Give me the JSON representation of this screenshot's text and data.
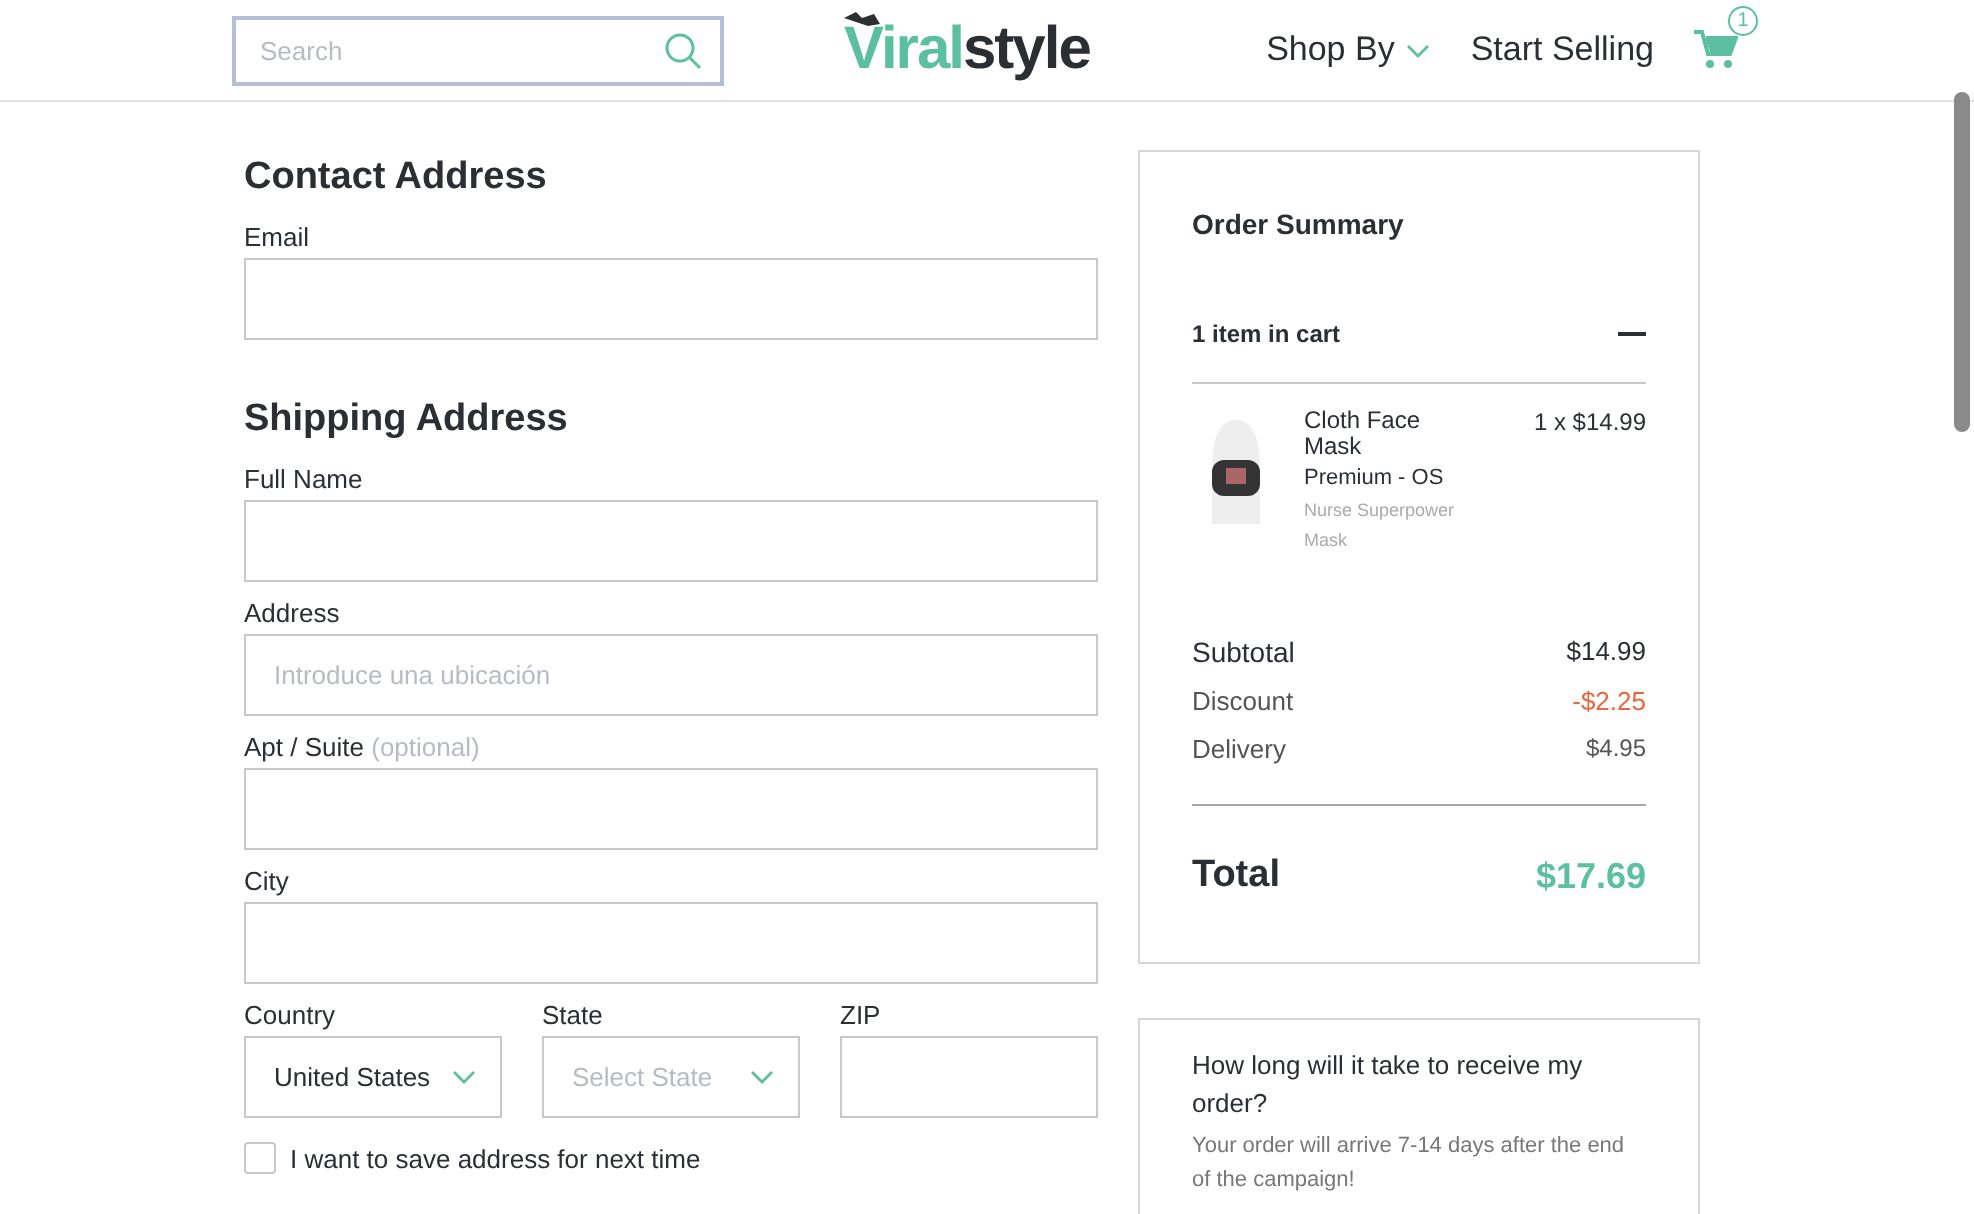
{
  "header": {
    "search": {
      "placeholder": "Search"
    },
    "logo": {
      "part_1": "Viral",
      "part_2": "style"
    },
    "nav": [
      {
        "label": "Shop By",
        "kind": "dropdown"
      },
      {
        "label": "Start Selling",
        "kind": "link"
      }
    ],
    "cart_count": "1"
  },
  "contact": {
    "title": "Contact Address",
    "fields": [
      {
        "label": "Email"
      }
    ]
  },
  "shipping": {
    "title": "Shipping Address",
    "fields": [
      {
        "label": "Full Name"
      },
      {
        "label": "Address",
        "placeholder": "Introduce una ubicación"
      },
      {
        "label": "Apt / Suite",
        "hint": "(optional)"
      },
      {
        "label": "City"
      }
    ],
    "row": [
      {
        "label": "Country",
        "kind": "select",
        "value": "United States"
      },
      {
        "label": "State",
        "kind": "select",
        "placeholder": "Select State"
      },
      {
        "label": "ZIP",
        "kind": "input"
      }
    ],
    "save": {
      "label": "I want to save address for next time",
      "checked": false
    }
  },
  "summary": {
    "title": "Order Summary",
    "cart_label": "1 item in cart",
    "expanded": true,
    "items": [
      {
        "name": "Cloth Face Mask",
        "variant": "Premium - OS",
        "design": "Nurse Superpower Mask",
        "qty": "1 x $14.99"
      }
    ],
    "lines": [
      {
        "label": "Subtotal",
        "value": "$14.99",
        "kind": "strong"
      },
      {
        "label": "Discount",
        "value": "-$2.25",
        "kind": "discount"
      },
      {
        "label": "Delivery",
        "value": "$4.95",
        "kind": "normal"
      }
    ],
    "total": {
      "label": "Total",
      "value": "$17.69"
    }
  },
  "faq": {
    "question": "How long will it take to receive my order?",
    "answer": "Your order will arrive 7-14 days after the end of the campaign!"
  }
}
